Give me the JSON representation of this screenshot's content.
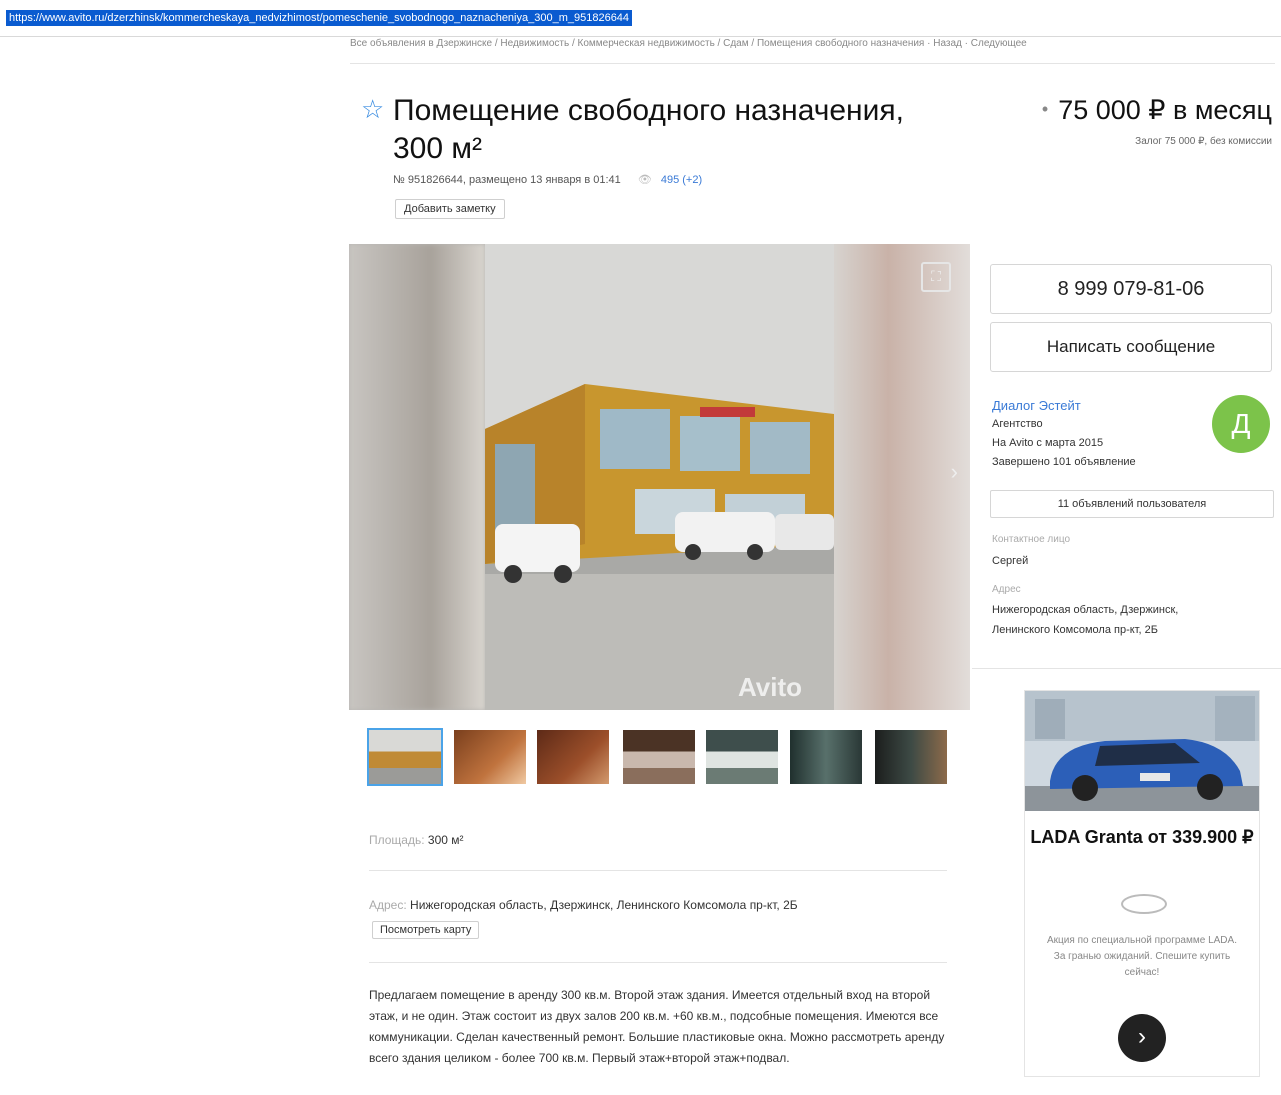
{
  "browser": {
    "url": "https://www.avito.ru/dzerzhinsk/kommercheskaya_nedvizhimost/pomeschenie_svobodnogo_naznacheniya_300_m_951826644"
  },
  "breadcrumbs": "Все объявления в Дзержинске / Недвижимость / Коммерческая недвижимость / Сдам / Помещения свободного назначения · Назад · Следующее",
  "listing": {
    "title": "Помещение свободного назначения, 300 м²",
    "meta": "№ 951826644, размещено 13 января в 01:41",
    "eye": "👁",
    "views": "495 (+2)",
    "add_note": "Добавить заметку",
    "price": "75 000 ₽ в месяц",
    "price_dot": "•",
    "deposit": "Залог 75 000 ₽, без комиссии"
  },
  "gallery": {
    "expand_icon": "⛶",
    "next_arrow": "›",
    "watermark": "Avito",
    "thumb_count": 7
  },
  "seller": {
    "phone": "8 999 079-81-06",
    "message": "Написать сообщение",
    "name": "Диалог Эстейт",
    "type": "Агентство",
    "since": "На Avito с марта 2015",
    "completed": "Завершено 101 объявление",
    "avatar_letter": "Д",
    "listings_btn": "11 объявлений пользователя",
    "contact_label": "Контактное лицо",
    "contact_name": "Сергей",
    "address_label": "Адрес",
    "address": "Нижегородская область, Дзержинск, Ленинского Комсомола пр-кт, 2Б"
  },
  "ad": {
    "title": "LADA Granta от 339.900 ₽",
    "text": "Акция по специальной программе LADA. За гранью ожиданий. Спешите купить сейчас!",
    "next": "›"
  },
  "params": {
    "area_label": "Площадь:",
    "area_value": "300 м²",
    "address_label": "Адрес:",
    "address_value": "Нижегородская область, Дзержинск, Ленинского Комсомола пр-кт, 2Б",
    "map_btn": "Посмотреть карту"
  },
  "description": "Предлагаем помещение в аренду 300 кв.м. Второй этаж здания. Имеется отдельный вход на второй этаж, и не один. Этаж состоит из двух залов 200 кв.м. +60 кв.м., подсобные помещения. Имеются все коммуникации. Сделан качественный ремонт. Большие пластиковые окна. Можно рассмотреть аренду всего здания целиком - более 700 кв.м. Первый этаж+второй этаж+подвал."
}
